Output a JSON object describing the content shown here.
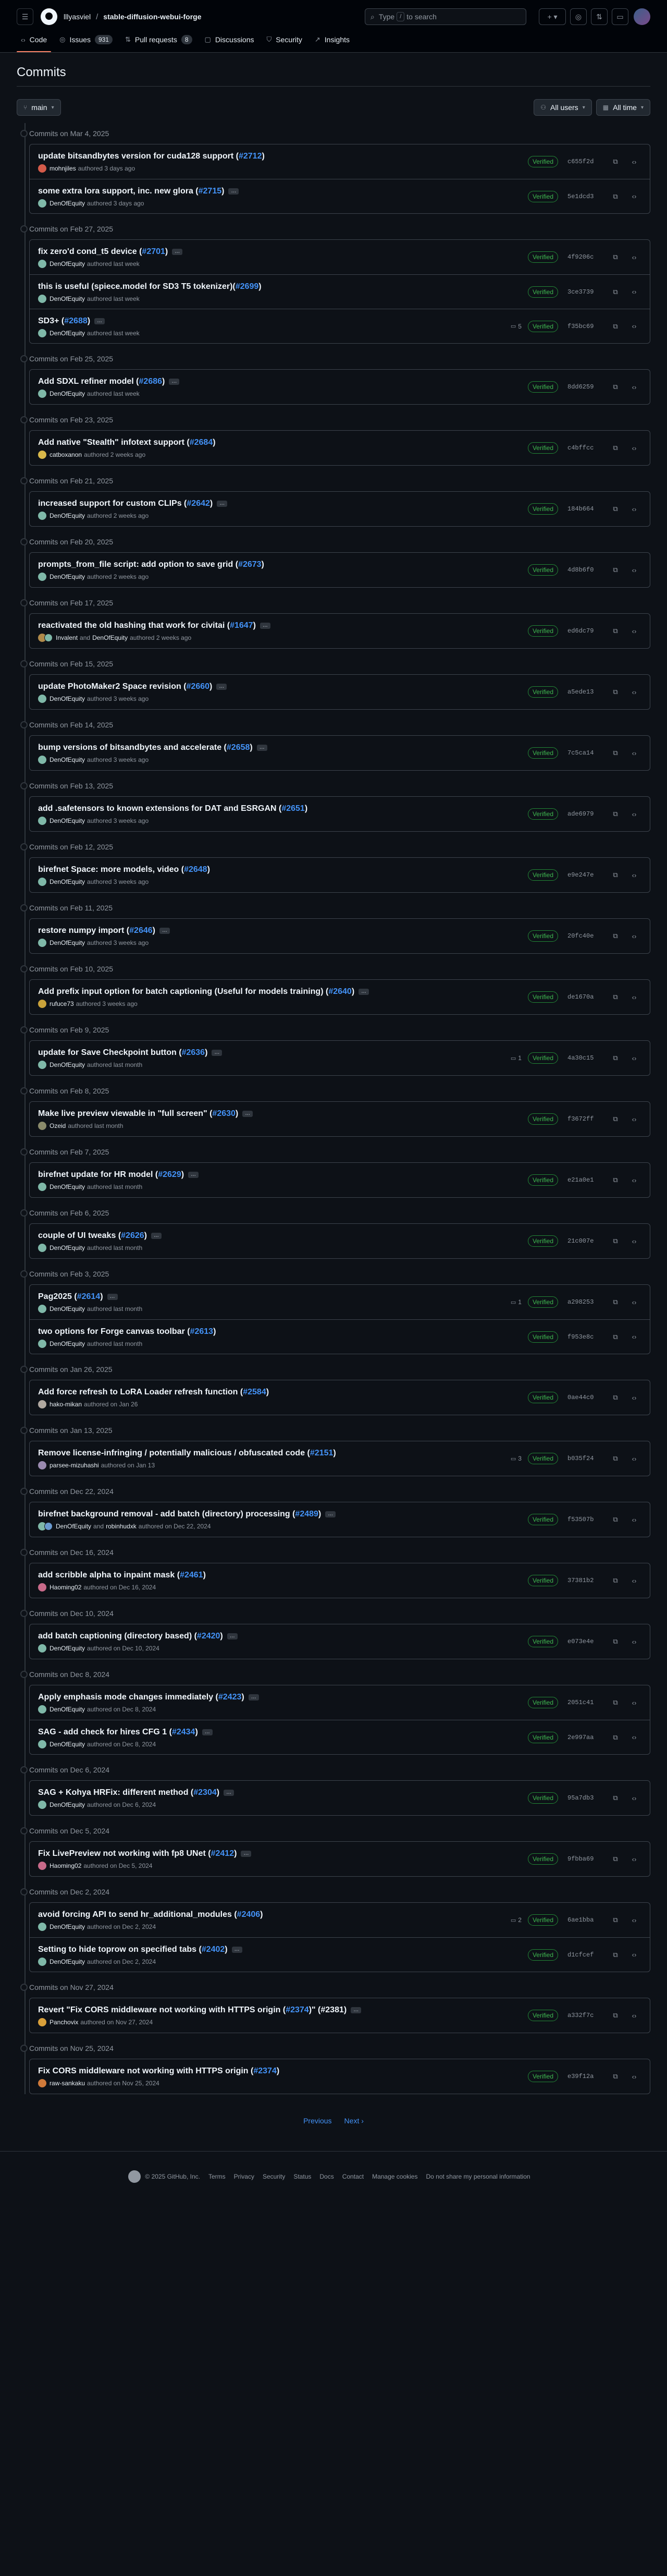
{
  "header": {
    "owner": "lllyasviel",
    "repo": "stable-diffusion-webui-forge",
    "search_prefix": "Type",
    "search_key": "/",
    "search_suffix": "to search"
  },
  "tabs": [
    {
      "label": "Code",
      "icon": "code-icon",
      "count": null,
      "active": true
    },
    {
      "label": "Issues",
      "icon": "issue-icon",
      "count": "931",
      "active": false
    },
    {
      "label": "Pull requests",
      "icon": "pull-request-icon",
      "count": "8",
      "active": false
    },
    {
      "label": "Discussions",
      "icon": "discussions-icon",
      "count": null,
      "active": false
    },
    {
      "label": "Security",
      "icon": "shield-icon",
      "count": null,
      "active": false
    },
    {
      "label": "Insights",
      "icon": "graph-icon",
      "count": null,
      "active": false
    }
  ],
  "page": {
    "title": "Commits",
    "branch": "main",
    "users_filter": "All users",
    "time_filter": "All time"
  },
  "verified_label": "Verified",
  "groups": [
    {
      "date": "Commits on Mar 4, 2025",
      "commits": [
        {
          "msg": "update bitsandbytes version for cuda128 support (",
          "pr": "#2712",
          "tail": ")",
          "ell": false,
          "authors": [
            "mohnjiles"
          ],
          "meta": "authored 3 days ago",
          "comments": "",
          "sha": "c655f2d",
          "av": [
            "#d45b4a"
          ]
        },
        {
          "msg": "some extra lora support, inc. new glora (",
          "pr": "#2715",
          "tail": ")",
          "ell": true,
          "authors": [
            "DenOfEquity"
          ],
          "meta": "authored 3 days ago",
          "comments": "",
          "sha": "5e1dcd3",
          "av": [
            "#7fb8a8"
          ]
        }
      ]
    },
    {
      "date": "Commits on Feb 27, 2025",
      "commits": [
        {
          "msg": "fix zero'd cond_t5 device (",
          "pr": "#2701",
          "tail": ")",
          "ell": true,
          "authors": [
            "DenOfEquity"
          ],
          "meta": "authored last week",
          "comments": "",
          "sha": "4f9206c",
          "av": [
            "#7fb8a8"
          ]
        },
        {
          "msg": "this is useful (spiece.model for SD3 T5 tokenizer)(",
          "pr": "#2699",
          "tail": ")",
          "ell": false,
          "authors": [
            "DenOfEquity"
          ],
          "meta": "authored last week",
          "comments": "",
          "sha": "3ce3739",
          "av": [
            "#7fb8a8"
          ]
        },
        {
          "msg": "SD3+ (",
          "pr": "#2688",
          "tail": ")",
          "ell": true,
          "authors": [
            "DenOfEquity"
          ],
          "meta": "authored last week",
          "comments": "5",
          "sha": "f35bc69",
          "av": [
            "#7fb8a8"
          ]
        }
      ]
    },
    {
      "date": "Commits on Feb 25, 2025",
      "commits": [
        {
          "msg": "Add SDXL refiner model (",
          "pr": "#2686",
          "tail": ")",
          "ell": true,
          "authors": [
            "DenOfEquity"
          ],
          "meta": "authored last week",
          "comments": "",
          "sha": "8dd6259",
          "av": [
            "#7fb8a8"
          ]
        }
      ]
    },
    {
      "date": "Commits on Feb 23, 2025",
      "commits": [
        {
          "msg": "Add native \"Stealth\" infotext support (",
          "pr": "#2684",
          "tail": ")",
          "ell": false,
          "authors": [
            "catboxanon"
          ],
          "meta": "authored 2 weeks ago",
          "comments": "",
          "sha": "c4bffcc",
          "av": [
            "#d9b84a"
          ]
        }
      ]
    },
    {
      "date": "Commits on Feb 21, 2025",
      "commits": [
        {
          "msg": "increased support for custom CLIPs (",
          "pr": "#2642",
          "tail": ")",
          "ell": true,
          "authors": [
            "DenOfEquity"
          ],
          "meta": "authored 2 weeks ago",
          "comments": "",
          "sha": "184b664",
          "av": [
            "#7fb8a8"
          ]
        }
      ]
    },
    {
      "date": "Commits on Feb 20, 2025",
      "commits": [
        {
          "msg": "prompts_from_file script: add option to save grid (",
          "pr": "#2673",
          "tail": ")",
          "ell": false,
          "authors": [
            "DenOfEquity"
          ],
          "meta": "authored 2 weeks ago",
          "comments": "",
          "sha": "4d8b6f0",
          "av": [
            "#7fb8a8"
          ]
        }
      ]
    },
    {
      "date": "Commits on Feb 17, 2025",
      "commits": [
        {
          "msg": "reactivated the old hashing that work for civitai (",
          "pr": "#1647",
          "tail": ")",
          "ell": true,
          "authors": [
            "Invalent",
            "DenOfEquity"
          ],
          "meta": "authored 2 weeks ago",
          "comments": "",
          "sha": "ed6dc79",
          "av": [
            "#b08a4a",
            "#7fb8a8"
          ]
        }
      ]
    },
    {
      "date": "Commits on Feb 15, 2025",
      "commits": [
        {
          "msg": "update PhotoMaker2 Space revision (",
          "pr": "#2660",
          "tail": ")",
          "ell": true,
          "authors": [
            "DenOfEquity"
          ],
          "meta": "authored 3 weeks ago",
          "comments": "",
          "sha": "a5ede13",
          "av": [
            "#7fb8a8"
          ]
        }
      ]
    },
    {
      "date": "Commits on Feb 14, 2025",
      "commits": [
        {
          "msg": "bump versions of bitsandbytes and accelerate (",
          "pr": "#2658",
          "tail": ")",
          "ell": true,
          "authors": [
            "DenOfEquity"
          ],
          "meta": "authored 3 weeks ago",
          "comments": "",
          "sha": "7c5ca14",
          "av": [
            "#7fb8a8"
          ]
        }
      ]
    },
    {
      "date": "Commits on Feb 13, 2025",
      "commits": [
        {
          "msg": "add .safetensors to known extensions for DAT and ESRGAN (",
          "pr": "#2651",
          "tail": ")",
          "ell": false,
          "authors": [
            "DenOfEquity"
          ],
          "meta": "authored 3 weeks ago",
          "comments": "",
          "sha": "ade6979",
          "av": [
            "#7fb8a8"
          ]
        }
      ]
    },
    {
      "date": "Commits on Feb 12, 2025",
      "commits": [
        {
          "msg": "birefnet Space: more models, video (",
          "pr": "#2648",
          "tail": ")",
          "ell": false,
          "authors": [
            "DenOfEquity"
          ],
          "meta": "authored 3 weeks ago",
          "comments": "",
          "sha": "e9e247e",
          "av": [
            "#7fb8a8"
          ]
        }
      ]
    },
    {
      "date": "Commits on Feb 11, 2025",
      "commits": [
        {
          "msg": "restore numpy import (",
          "pr": "#2646",
          "tail": ")",
          "ell": true,
          "authors": [
            "DenOfEquity"
          ],
          "meta": "authored 3 weeks ago",
          "comments": "",
          "sha": "20fc40e",
          "av": [
            "#7fb8a8"
          ]
        }
      ]
    },
    {
      "date": "Commits on Feb 10, 2025",
      "commits": [
        {
          "msg": "Add prefix input option for batch captioning (Useful for models training) (",
          "pr": "#2640",
          "tail": ")",
          "ell": true,
          "authors": [
            "rufuce73"
          ],
          "meta": "authored 3 weeks ago",
          "comments": "",
          "sha": "de1670a",
          "av": [
            "#c9a23a"
          ]
        }
      ]
    },
    {
      "date": "Commits on Feb 9, 2025",
      "commits": [
        {
          "msg": "update for Save Checkpoint button (",
          "pr": "#2636",
          "tail": ")",
          "ell": true,
          "authors": [
            "DenOfEquity"
          ],
          "meta": "authored last month",
          "comments": "1",
          "sha": "4a30c15",
          "av": [
            "#7fb8a8"
          ]
        }
      ]
    },
    {
      "date": "Commits on Feb 8, 2025",
      "commits": [
        {
          "msg": "Make live preview viewable in \"full screen\" (",
          "pr": "#2630",
          "tail": ")",
          "ell": true,
          "authors": [
            "Ozeid"
          ],
          "meta": "authored last month",
          "comments": "",
          "sha": "f3672ff",
          "av": [
            "#8a8a6a"
          ]
        }
      ]
    },
    {
      "date": "Commits on Feb 7, 2025",
      "commits": [
        {
          "msg": "birefnet update for HR model (",
          "pr": "#2629",
          "tail": ")",
          "ell": true,
          "authors": [
            "DenOfEquity"
          ],
          "meta": "authored last month",
          "comments": "",
          "sha": "e21a0e1",
          "av": [
            "#7fb8a8"
          ]
        }
      ]
    },
    {
      "date": "Commits on Feb 6, 2025",
      "commits": [
        {
          "msg": "couple of UI tweaks (",
          "pr": "#2626",
          "tail": ")",
          "ell": true,
          "authors": [
            "DenOfEquity"
          ],
          "meta": "authored last month",
          "comments": "",
          "sha": "21c007e",
          "av": [
            "#7fb8a8"
          ]
        }
      ]
    },
    {
      "date": "Commits on Feb 3, 2025",
      "commits": [
        {
          "msg": "Pag2025 (",
          "pr": "#2614",
          "tail": ")",
          "ell": true,
          "authors": [
            "DenOfEquity"
          ],
          "meta": "authored last month",
          "comments": "1",
          "sha": "a298253",
          "av": [
            "#7fb8a8"
          ]
        },
        {
          "msg": "two options for Forge canvas toolbar (",
          "pr": "#2613",
          "tail": ")",
          "ell": false,
          "authors": [
            "DenOfEquity"
          ],
          "meta": "authored last month",
          "comments": "",
          "sha": "f953e8c",
          "av": [
            "#7fb8a8"
          ]
        }
      ]
    },
    {
      "date": "Commits on Jan 26, 2025",
      "commits": [
        {
          "msg": "Add force refresh to LoRA Loader refresh function (",
          "pr": "#2584",
          "tail": ")",
          "ell": false,
          "authors": [
            "hako-mikan"
          ],
          "meta": "authored on Jan 26",
          "comments": "",
          "sha": "0ae44c0",
          "av": [
            "#b0a8a0"
          ]
        }
      ]
    },
    {
      "date": "Commits on Jan 13, 2025",
      "commits": [
        {
          "msg": "Remove license-infringing / potentially malicious / obfuscated code (",
          "pr": "#2151",
          "tail": ")",
          "ell": false,
          "authors": [
            "parsee-mizuhashi"
          ],
          "meta": "authored on Jan 13",
          "comments": "3",
          "sha": "b035f24",
          "av": [
            "#9a8ab0"
          ]
        }
      ]
    },
    {
      "date": "Commits on Dec 22, 2024",
      "commits": [
        {
          "msg": "birefnet background removal - add batch (directory) processing (",
          "pr": "#2489",
          "tail": ")",
          "ell": true,
          "authors": [
            "DenOfEquity",
            "robinhudxk"
          ],
          "meta": "authored on Dec 22, 2024",
          "comments": "",
          "sha": "f53507b",
          "av": [
            "#7fb8a8",
            "#6a9ad0"
          ]
        }
      ]
    },
    {
      "date": "Commits on Dec 16, 2024",
      "commits": [
        {
          "msg": "add scribble alpha to inpaint mask (",
          "pr": "#2461",
          "tail": ")",
          "ell": false,
          "authors": [
            "Haoming02"
          ],
          "meta": "authored on Dec 16, 2024",
          "comments": "",
          "sha": "37381b2",
          "av": [
            "#c86a8a"
          ]
        }
      ]
    },
    {
      "date": "Commits on Dec 10, 2024",
      "commits": [
        {
          "msg": "add batch captioning (directory based) (",
          "pr": "#2420",
          "tail": ")",
          "ell": true,
          "authors": [
            "DenOfEquity"
          ],
          "meta": "authored on Dec 10, 2024",
          "comments": "",
          "sha": "e073e4e",
          "av": [
            "#7fb8a8"
          ]
        }
      ]
    },
    {
      "date": "Commits on Dec 8, 2024",
      "commits": [
        {
          "msg": "Apply emphasis mode changes immediately (",
          "pr": "#2423",
          "tail": ")",
          "ell": true,
          "authors": [
            "DenOfEquity"
          ],
          "meta": "authored on Dec 8, 2024",
          "comments": "",
          "sha": "2051c41",
          "av": [
            "#7fb8a8"
          ]
        },
        {
          "msg": "SAG - add check for hires CFG 1 (",
          "pr": "#2434",
          "tail": ")",
          "ell": true,
          "authors": [
            "DenOfEquity"
          ],
          "meta": "authored on Dec 8, 2024",
          "comments": "",
          "sha": "2e997aa",
          "av": [
            "#7fb8a8"
          ]
        }
      ]
    },
    {
      "date": "Commits on Dec 6, 2024",
      "commits": [
        {
          "msg": "SAG + Kohya HRFix: different method (",
          "pr": "#2304",
          "tail": ")",
          "ell": true,
          "authors": [
            "DenOfEquity"
          ],
          "meta": "authored on Dec 6, 2024",
          "comments": "",
          "sha": "95a7db3",
          "av": [
            "#7fb8a8"
          ]
        }
      ]
    },
    {
      "date": "Commits on Dec 5, 2024",
      "commits": [
        {
          "msg": "Fix LivePreview not working with fp8 UNet (",
          "pr": "#2412",
          "tail": ")",
          "ell": true,
          "authors": [
            "Haoming02"
          ],
          "meta": "authored on Dec 5, 2024",
          "comments": "",
          "sha": "9fbba69",
          "av": [
            "#c86a8a"
          ]
        }
      ]
    },
    {
      "date": "Commits on Dec 2, 2024",
      "commits": [
        {
          "msg": "avoid forcing API to send hr_additional_modules (",
          "pr": "#2406",
          "tail": ")",
          "ell": false,
          "authors": [
            "DenOfEquity"
          ],
          "meta": "authored on Dec 2, 2024",
          "comments": "2",
          "sha": "6ae1bba",
          "av": [
            "#7fb8a8"
          ]
        },
        {
          "msg": "Setting to hide toprow on specified tabs (",
          "pr": "#2402",
          "tail": ")",
          "ell": true,
          "authors": [
            "DenOfEquity"
          ],
          "meta": "authored on Dec 2, 2024",
          "comments": "",
          "sha": "d1cfcef",
          "av": [
            "#7fb8a8"
          ]
        }
      ]
    },
    {
      "date": "Commits on Nov 27, 2024",
      "commits": [
        {
          "msg": "Revert \"Fix CORS middleware not working with HTTPS origin (",
          "pr": "#2374",
          "tail": ")\" (#2381)",
          "ell": true,
          "authors": [
            "Panchovix"
          ],
          "meta": "authored on Nov 27, 2024",
          "comments": "",
          "sha": "a332f7c",
          "av": [
            "#d9a03a"
          ]
        }
      ]
    },
    {
      "date": "Commits on Nov 25, 2024",
      "commits": [
        {
          "msg": "Fix CORS middleware not working with HTTPS origin (",
          "pr": "#2374",
          "tail": ")",
          "ell": false,
          "authors": [
            "raw-sankaku"
          ],
          "meta": "authored on Nov 25, 2024",
          "comments": "",
          "sha": "e39f12a",
          "av": [
            "#d07a3a"
          ]
        }
      ]
    }
  ],
  "pagination": {
    "prev": "Previous",
    "next": "Next"
  },
  "footer": {
    "copyright": "© 2025 GitHub, Inc.",
    "links": [
      "Terms",
      "Privacy",
      "Security",
      "Status",
      "Docs",
      "Contact",
      "Manage cookies",
      "Do not share my personal information"
    ]
  }
}
